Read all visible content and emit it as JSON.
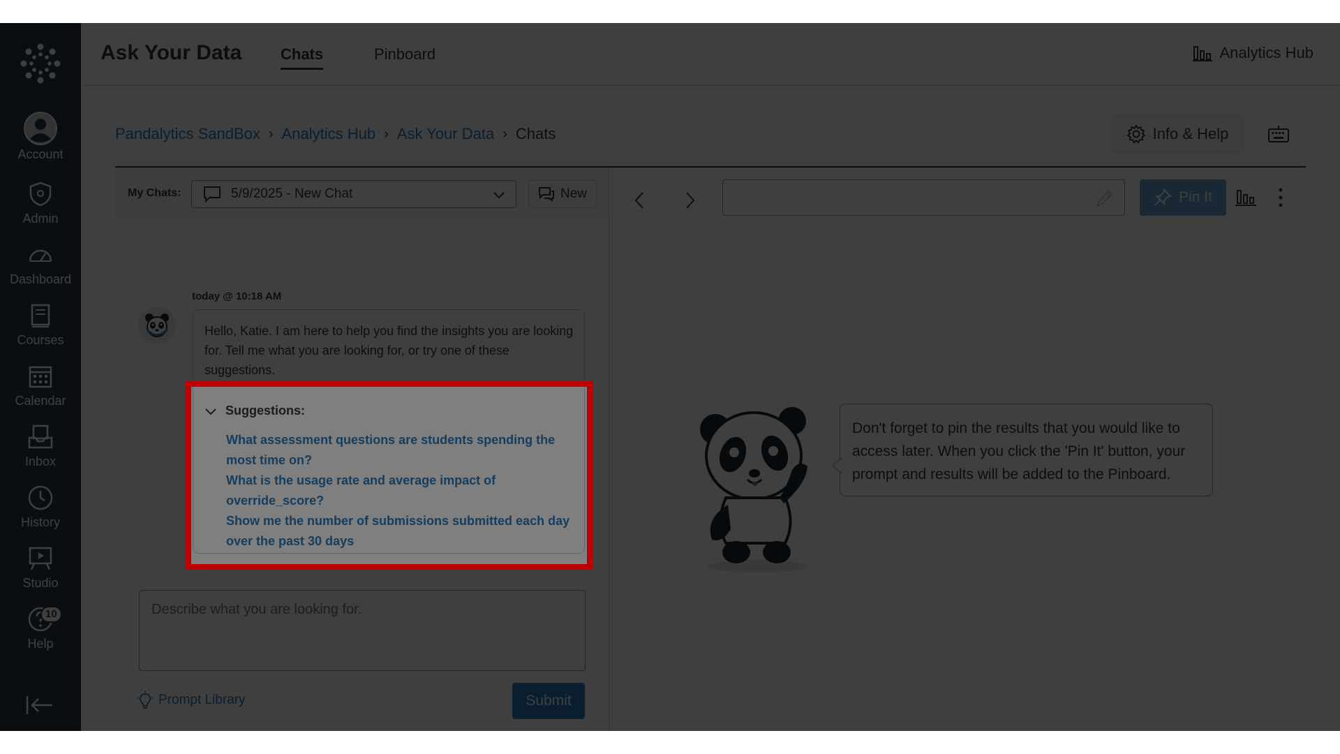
{
  "global_nav": {
    "items": [
      {
        "label": "Account",
        "icon": "account-icon"
      },
      {
        "label": "Admin",
        "icon": "admin-shield-icon"
      },
      {
        "label": "Dashboard",
        "icon": "dashboard-icon"
      },
      {
        "label": "Courses",
        "icon": "courses-book-icon"
      },
      {
        "label": "Calendar",
        "icon": "calendar-icon"
      },
      {
        "label": "Inbox",
        "icon": "inbox-icon"
      },
      {
        "label": "History",
        "icon": "history-clock-icon"
      },
      {
        "label": "Studio",
        "icon": "studio-icon"
      },
      {
        "label": "Help",
        "icon": "help-icon",
        "badge": "10"
      }
    ]
  },
  "header": {
    "title": "Ask Your Data",
    "tabs": [
      {
        "label": "Chats",
        "active": true
      },
      {
        "label": "Pinboard",
        "active": false
      }
    ],
    "hub_link": "Analytics Hub"
  },
  "breadcrumb": {
    "links": [
      "Pandalytics SandBox",
      "Analytics Hub",
      "Ask Your Data"
    ],
    "current": "Chats"
  },
  "info_help_label": "Info & Help",
  "chat_toolbar": {
    "my_chats_label": "My Chats:",
    "selected_chat": "5/9/2025 - New Chat",
    "new_label": "New"
  },
  "message": {
    "timestamp": "today @ 10:18 AM",
    "text": "Hello, Katie. I am here to help you find the insights you are looking for. Tell me what you are looking for, or try one of these suggestions.",
    "suggestions_heading": "Suggestions:",
    "suggestions": [
      "What assessment questions are students spending the most time on?",
      "What is the usage rate and average impact of override_score?",
      "Show me the number of submissions submitted each day over the past 30 days"
    ]
  },
  "prompt": {
    "placeholder": "Describe what you are looking for.",
    "value": "",
    "library_label": "Prompt Library",
    "submit_label": "Submit"
  },
  "results": {
    "title_value": "",
    "pin_label": "Pin It",
    "tip": "Don't forget to pin the results that you would like to access later. When you click the 'Pin It' button, your prompt and results will be added to the Pinboard."
  },
  "colors": {
    "nav_bg": "#2d3b45",
    "link": "#2b7abc",
    "highlight": "#c00000",
    "pin_button": "#6aa0d6"
  }
}
